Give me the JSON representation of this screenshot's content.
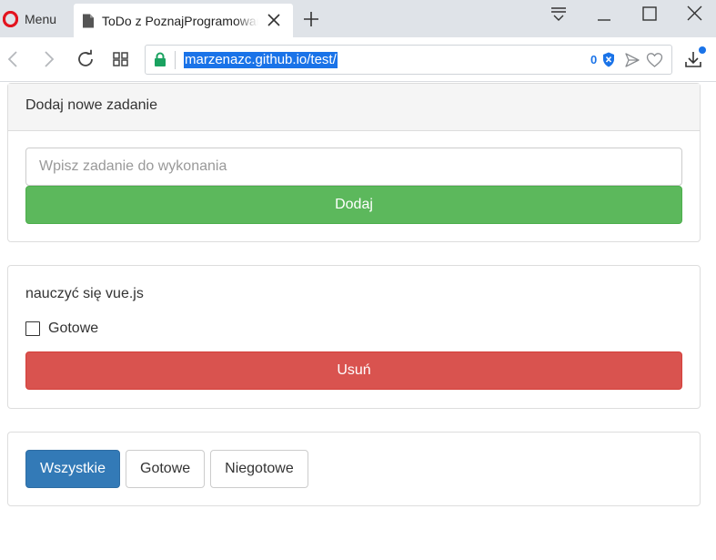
{
  "browser": {
    "menu_label": "Menu",
    "tab_title": "ToDo z PoznajProgramowanie",
    "url": "marzenazc.github.io/test/",
    "ad_block_count": "0"
  },
  "add_panel": {
    "heading": "Dodaj nowe zadanie",
    "input_placeholder": "Wpisz zadanie do wykonania",
    "input_value": "",
    "add_button": "Dodaj"
  },
  "tasks": [
    {
      "text": "nauczyć się vue.js",
      "done_label": "Gotowe",
      "done": false,
      "delete_button": "Usuń"
    }
  ],
  "filters": {
    "items": [
      {
        "label": "Wszystkie",
        "active": true
      },
      {
        "label": "Gotowe",
        "active": false
      },
      {
        "label": "Niegotowe",
        "active": false
      }
    ]
  },
  "colors": {
    "success": "#5cb85c",
    "danger": "#d9534f",
    "primary": "#337ab7",
    "url_highlight": "#1a73e8"
  }
}
